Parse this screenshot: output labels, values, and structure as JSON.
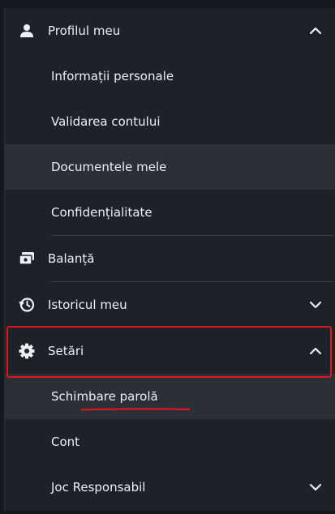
{
  "menu": {
    "profile": {
      "label": "Profilul meu",
      "icon": "user-icon",
      "expanded": true
    },
    "profile_items": [
      {
        "label": "Informații personale"
      },
      {
        "label": "Validarea contului"
      },
      {
        "label": "Documentele mele",
        "active": true
      },
      {
        "label": "Confidențialitate"
      }
    ],
    "balance": {
      "label": "Balanță",
      "icon": "wallet-icon"
    },
    "history": {
      "label": "Istoricul meu",
      "icon": "history-icon",
      "expanded": false
    },
    "settings": {
      "label": "Setări",
      "icon": "gear-icon",
      "expanded": true
    },
    "settings_items": [
      {
        "label": "Schimbare parolă",
        "active": true
      },
      {
        "label": "Cont"
      },
      {
        "label": "Joc Responsabil",
        "expandable": true
      }
    ]
  },
  "colors": {
    "background": "#1d212a",
    "active_row": "#2a2f38",
    "text": "#eef0f3",
    "annotation": "#e3141c"
  }
}
